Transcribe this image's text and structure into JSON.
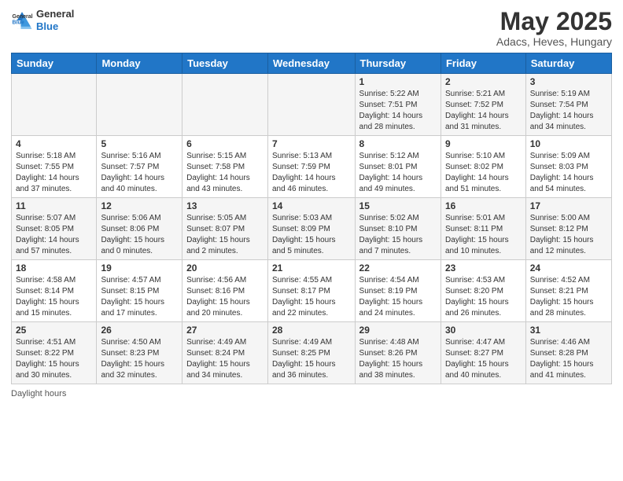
{
  "header": {
    "logo_general": "General",
    "logo_blue": "Blue",
    "title": "May 2025",
    "subtitle": "Adacs, Heves, Hungary"
  },
  "footer": {
    "daylight_label": "Daylight hours"
  },
  "weekdays": [
    "Sunday",
    "Monday",
    "Tuesday",
    "Wednesday",
    "Thursday",
    "Friday",
    "Saturday"
  ],
  "weeks": [
    [
      {
        "day": "",
        "info": ""
      },
      {
        "day": "",
        "info": ""
      },
      {
        "day": "",
        "info": ""
      },
      {
        "day": "",
        "info": ""
      },
      {
        "day": "1",
        "info": "Sunrise: 5:22 AM\nSunset: 7:51 PM\nDaylight: 14 hours and 28 minutes."
      },
      {
        "day": "2",
        "info": "Sunrise: 5:21 AM\nSunset: 7:52 PM\nDaylight: 14 hours and 31 minutes."
      },
      {
        "day": "3",
        "info": "Sunrise: 5:19 AM\nSunset: 7:54 PM\nDaylight: 14 hours and 34 minutes."
      }
    ],
    [
      {
        "day": "4",
        "info": "Sunrise: 5:18 AM\nSunset: 7:55 PM\nDaylight: 14 hours and 37 minutes."
      },
      {
        "day": "5",
        "info": "Sunrise: 5:16 AM\nSunset: 7:57 PM\nDaylight: 14 hours and 40 minutes."
      },
      {
        "day": "6",
        "info": "Sunrise: 5:15 AM\nSunset: 7:58 PM\nDaylight: 14 hours and 43 minutes."
      },
      {
        "day": "7",
        "info": "Sunrise: 5:13 AM\nSunset: 7:59 PM\nDaylight: 14 hours and 46 minutes."
      },
      {
        "day": "8",
        "info": "Sunrise: 5:12 AM\nSunset: 8:01 PM\nDaylight: 14 hours and 49 minutes."
      },
      {
        "day": "9",
        "info": "Sunrise: 5:10 AM\nSunset: 8:02 PM\nDaylight: 14 hours and 51 minutes."
      },
      {
        "day": "10",
        "info": "Sunrise: 5:09 AM\nSunset: 8:03 PM\nDaylight: 14 hours and 54 minutes."
      }
    ],
    [
      {
        "day": "11",
        "info": "Sunrise: 5:07 AM\nSunset: 8:05 PM\nDaylight: 14 hours and 57 minutes."
      },
      {
        "day": "12",
        "info": "Sunrise: 5:06 AM\nSunset: 8:06 PM\nDaylight: 15 hours and 0 minutes."
      },
      {
        "day": "13",
        "info": "Sunrise: 5:05 AM\nSunset: 8:07 PM\nDaylight: 15 hours and 2 minutes."
      },
      {
        "day": "14",
        "info": "Sunrise: 5:03 AM\nSunset: 8:09 PM\nDaylight: 15 hours and 5 minutes."
      },
      {
        "day": "15",
        "info": "Sunrise: 5:02 AM\nSunset: 8:10 PM\nDaylight: 15 hours and 7 minutes."
      },
      {
        "day": "16",
        "info": "Sunrise: 5:01 AM\nSunset: 8:11 PM\nDaylight: 15 hours and 10 minutes."
      },
      {
        "day": "17",
        "info": "Sunrise: 5:00 AM\nSunset: 8:12 PM\nDaylight: 15 hours and 12 minutes."
      }
    ],
    [
      {
        "day": "18",
        "info": "Sunrise: 4:58 AM\nSunset: 8:14 PM\nDaylight: 15 hours and 15 minutes."
      },
      {
        "day": "19",
        "info": "Sunrise: 4:57 AM\nSunset: 8:15 PM\nDaylight: 15 hours and 17 minutes."
      },
      {
        "day": "20",
        "info": "Sunrise: 4:56 AM\nSunset: 8:16 PM\nDaylight: 15 hours and 20 minutes."
      },
      {
        "day": "21",
        "info": "Sunrise: 4:55 AM\nSunset: 8:17 PM\nDaylight: 15 hours and 22 minutes."
      },
      {
        "day": "22",
        "info": "Sunrise: 4:54 AM\nSunset: 8:19 PM\nDaylight: 15 hours and 24 minutes."
      },
      {
        "day": "23",
        "info": "Sunrise: 4:53 AM\nSunset: 8:20 PM\nDaylight: 15 hours and 26 minutes."
      },
      {
        "day": "24",
        "info": "Sunrise: 4:52 AM\nSunset: 8:21 PM\nDaylight: 15 hours and 28 minutes."
      }
    ],
    [
      {
        "day": "25",
        "info": "Sunrise: 4:51 AM\nSunset: 8:22 PM\nDaylight: 15 hours and 30 minutes."
      },
      {
        "day": "26",
        "info": "Sunrise: 4:50 AM\nSunset: 8:23 PM\nDaylight: 15 hours and 32 minutes."
      },
      {
        "day": "27",
        "info": "Sunrise: 4:49 AM\nSunset: 8:24 PM\nDaylight: 15 hours and 34 minutes."
      },
      {
        "day": "28",
        "info": "Sunrise: 4:49 AM\nSunset: 8:25 PM\nDaylight: 15 hours and 36 minutes."
      },
      {
        "day": "29",
        "info": "Sunrise: 4:48 AM\nSunset: 8:26 PM\nDaylight: 15 hours and 38 minutes."
      },
      {
        "day": "30",
        "info": "Sunrise: 4:47 AM\nSunset: 8:27 PM\nDaylight: 15 hours and 40 minutes."
      },
      {
        "day": "31",
        "info": "Sunrise: 4:46 AM\nSunset: 8:28 PM\nDaylight: 15 hours and 41 minutes."
      }
    ]
  ]
}
